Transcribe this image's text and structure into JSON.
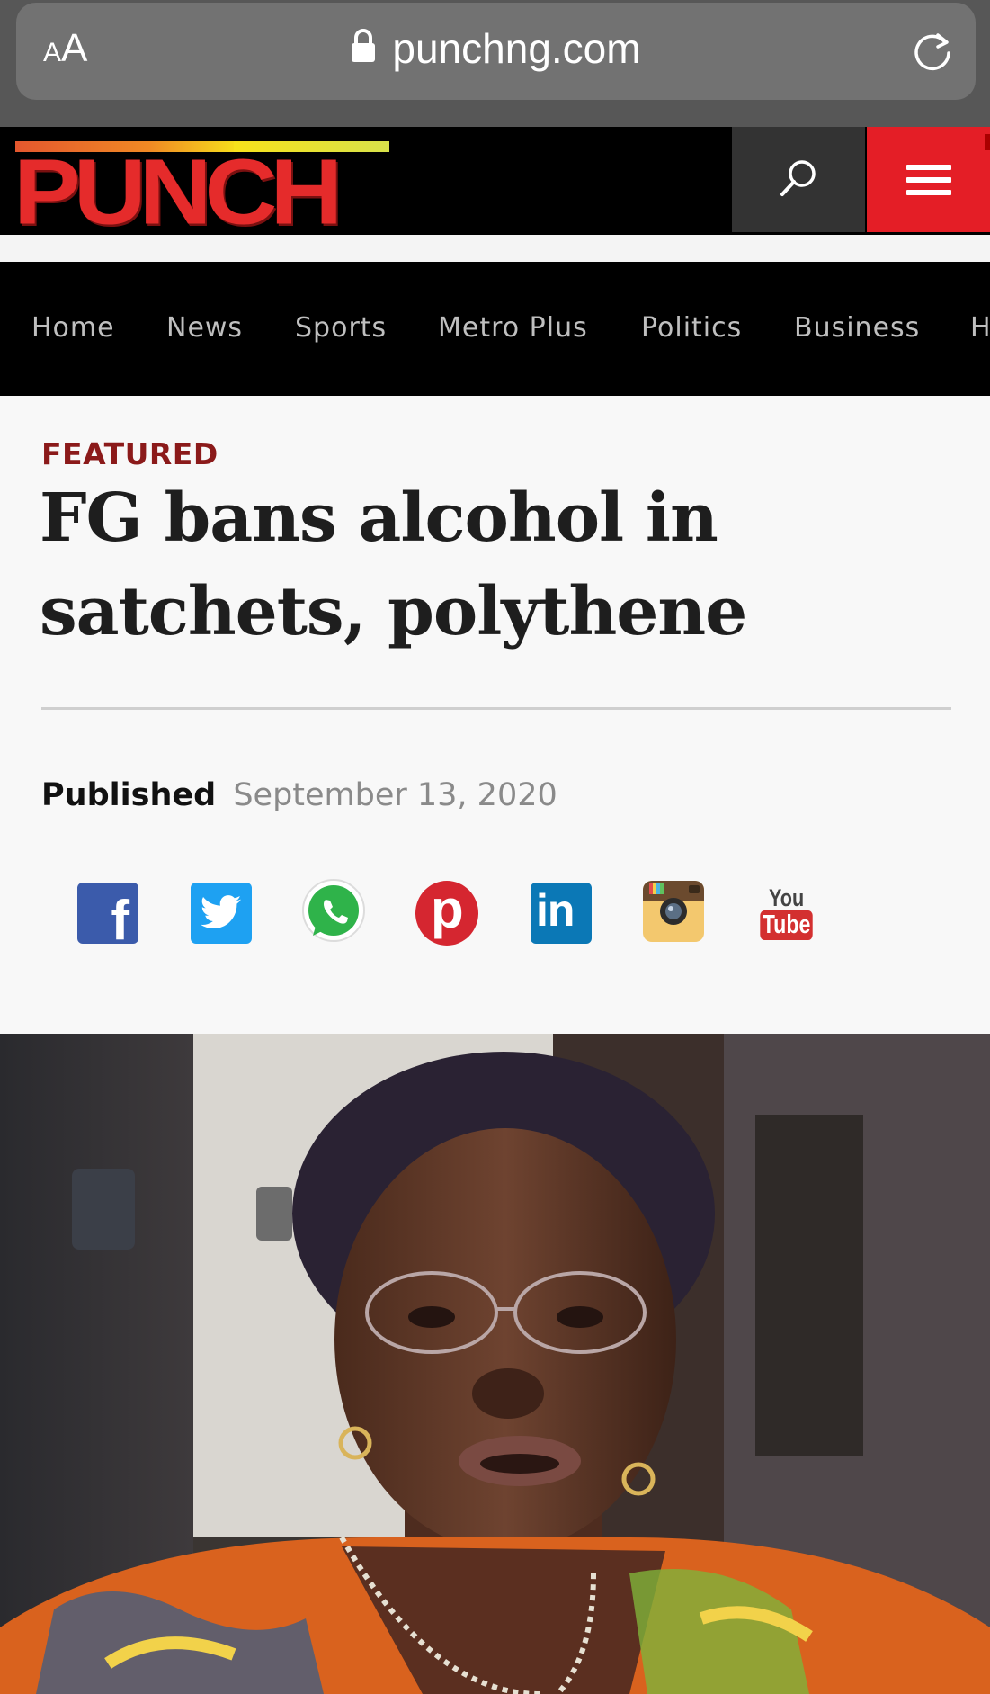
{
  "browser": {
    "text_size_small": "A",
    "text_size_big": "A",
    "url": "punchng.com"
  },
  "site": {
    "logo_text": "PUNCH",
    "colors": {
      "brand_red": "#e41e26",
      "logo_stripe_orange": "#f08a24",
      "logo_stripe_yellow": "#f7e21b"
    }
  },
  "nav": {
    "items": [
      {
        "label": "Home"
      },
      {
        "label": "News"
      },
      {
        "label": "Sports"
      },
      {
        "label": "Metro Plus"
      },
      {
        "label": "Politics"
      },
      {
        "label": "Business"
      },
      {
        "label": "H"
      }
    ]
  },
  "article": {
    "kicker": "FEATURED",
    "headline": "FG bans alcohol in satchets, polythene",
    "published_label": "Published",
    "published_date": "September 13, 2020"
  },
  "share": {
    "items": [
      {
        "icon": "facebook-icon",
        "glyph": "f"
      },
      {
        "icon": "twitter-icon"
      },
      {
        "icon": "whatsapp-icon"
      },
      {
        "icon": "pinterest-icon",
        "glyph": "p"
      },
      {
        "icon": "linkedin-icon",
        "glyph": "in"
      },
      {
        "icon": "instagram-icon"
      },
      {
        "icon": "youtube-icon",
        "glyph_top": "You",
        "glyph_bottom": "Tube"
      }
    ]
  }
}
